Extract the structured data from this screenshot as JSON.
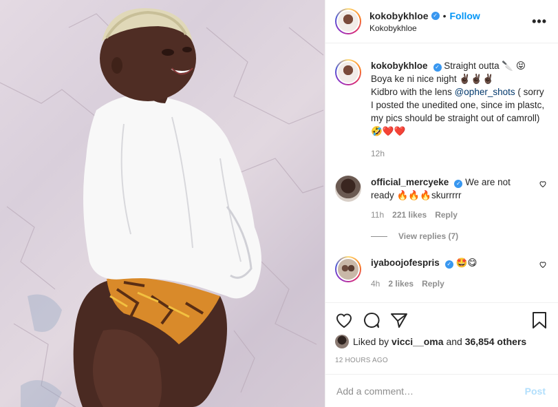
{
  "header": {
    "username": "kokobykhloe",
    "follow_label": "Follow",
    "dot": "•",
    "subtitle": "Kokobykhloe",
    "more_label": "•••"
  },
  "caption": {
    "username": "kokobykhloe",
    "text_line1": "Straight outta 🔪 😝",
    "text_line2": "Boya ke ni nice night ✌🏿✌🏿✌🏿",
    "text_line3_prefix": "Kidbro with the lens",
    "mention": "@opher_shots",
    "text_line3_suffix": "( sorry I posted the unedited one, since im plastc, my pics should be straight out of camroll)🤣❤️❤️",
    "time": "12h"
  },
  "comments": [
    {
      "username": "official_mercyeke",
      "text": "We are not ready 🔥🔥🔥skurrrrr",
      "time": "11h",
      "likes": "221 likes",
      "reply": "Reply",
      "view_replies": "View replies (7)"
    },
    {
      "username": "iyaboojofespris",
      "text": "🤩😋",
      "time": "4h",
      "likes": "2 likes",
      "reply": "Reply"
    }
  ],
  "likes": {
    "prefix": "Liked by",
    "user": "vicci__oma",
    "middle": "and",
    "others": "36,854 others"
  },
  "date": "12 HOURS AGO",
  "add_comment": {
    "placeholder": "Add a comment…",
    "post_label": "Post"
  },
  "colors": {
    "accent": "#0095f6",
    "verified": "#3897f0",
    "muted": "#8e8e8e",
    "post_disabled": "#b2dffc"
  }
}
